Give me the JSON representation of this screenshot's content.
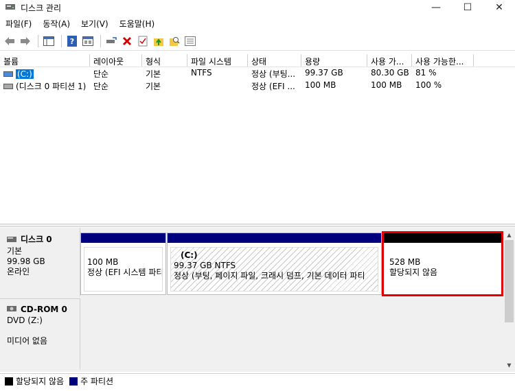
{
  "window": {
    "title": "디스크 관리",
    "minimize_glyph": "—",
    "maximize_glyph": "☐",
    "close_glyph": "✕"
  },
  "menu": [
    "파일(F)",
    "동작(A)",
    "보기(V)",
    "도움말(H)"
  ],
  "toolbar": {
    "icons": [
      "back-arrow-icon",
      "forward-arrow-icon",
      "console-tree-icon",
      "help-icon",
      "properties-icon",
      "connect-disk-icon",
      "delete-icon",
      "check-icon",
      "up-folder-icon",
      "search-icon",
      "list-icon"
    ]
  },
  "volumes": {
    "columns": [
      "볼륨",
      "레이아웃",
      "형식",
      "파일 시스템",
      "상태",
      "용량",
      "사용 가...",
      "사용 가능한..."
    ],
    "rows": [
      {
        "name": "(C:)",
        "layout": "단순",
        "type": "기본",
        "fs": "NTFS",
        "status": "정상 (부팅...",
        "capacity": "99.37 GB",
        "free": "80.30 GB",
        "free_pct": "81 %"
      },
      {
        "name": "(디스크 0 파티션 1)",
        "layout": "단순",
        "type": "기본",
        "fs": "",
        "status": "정상 (EFI ...",
        "capacity": "100 MB",
        "free": "100 MB",
        "free_pct": "100 %"
      }
    ]
  },
  "disks": [
    {
      "title": "디스크 0",
      "lines": [
        "기본",
        "99.98 GB",
        "온라인"
      ],
      "partitions": [
        {
          "name": "",
          "size": "100 MB",
          "desc": "정상 (EFI 시스템 파티",
          "bar_color": "#00007f"
        },
        {
          "name": "(C:)",
          "size": "99.37 GB NTFS",
          "desc": "정상 (부팅, 페이지 파일, 크래시 덤프, 기본 데이터 파티",
          "bar_color": "#00007f"
        },
        {
          "name": "",
          "size": "528 MB",
          "desc": "할당되지 않음",
          "bar_color": "#000000"
        }
      ]
    },
    {
      "title": "CD-ROM 0",
      "lines": [
        "DVD (Z:)",
        "",
        "미디어 없음"
      ]
    }
  ],
  "legend": [
    {
      "label": "할당되지 않음",
      "color": "#000000"
    },
    {
      "label": "주 파티션",
      "color": "#00007f"
    }
  ]
}
